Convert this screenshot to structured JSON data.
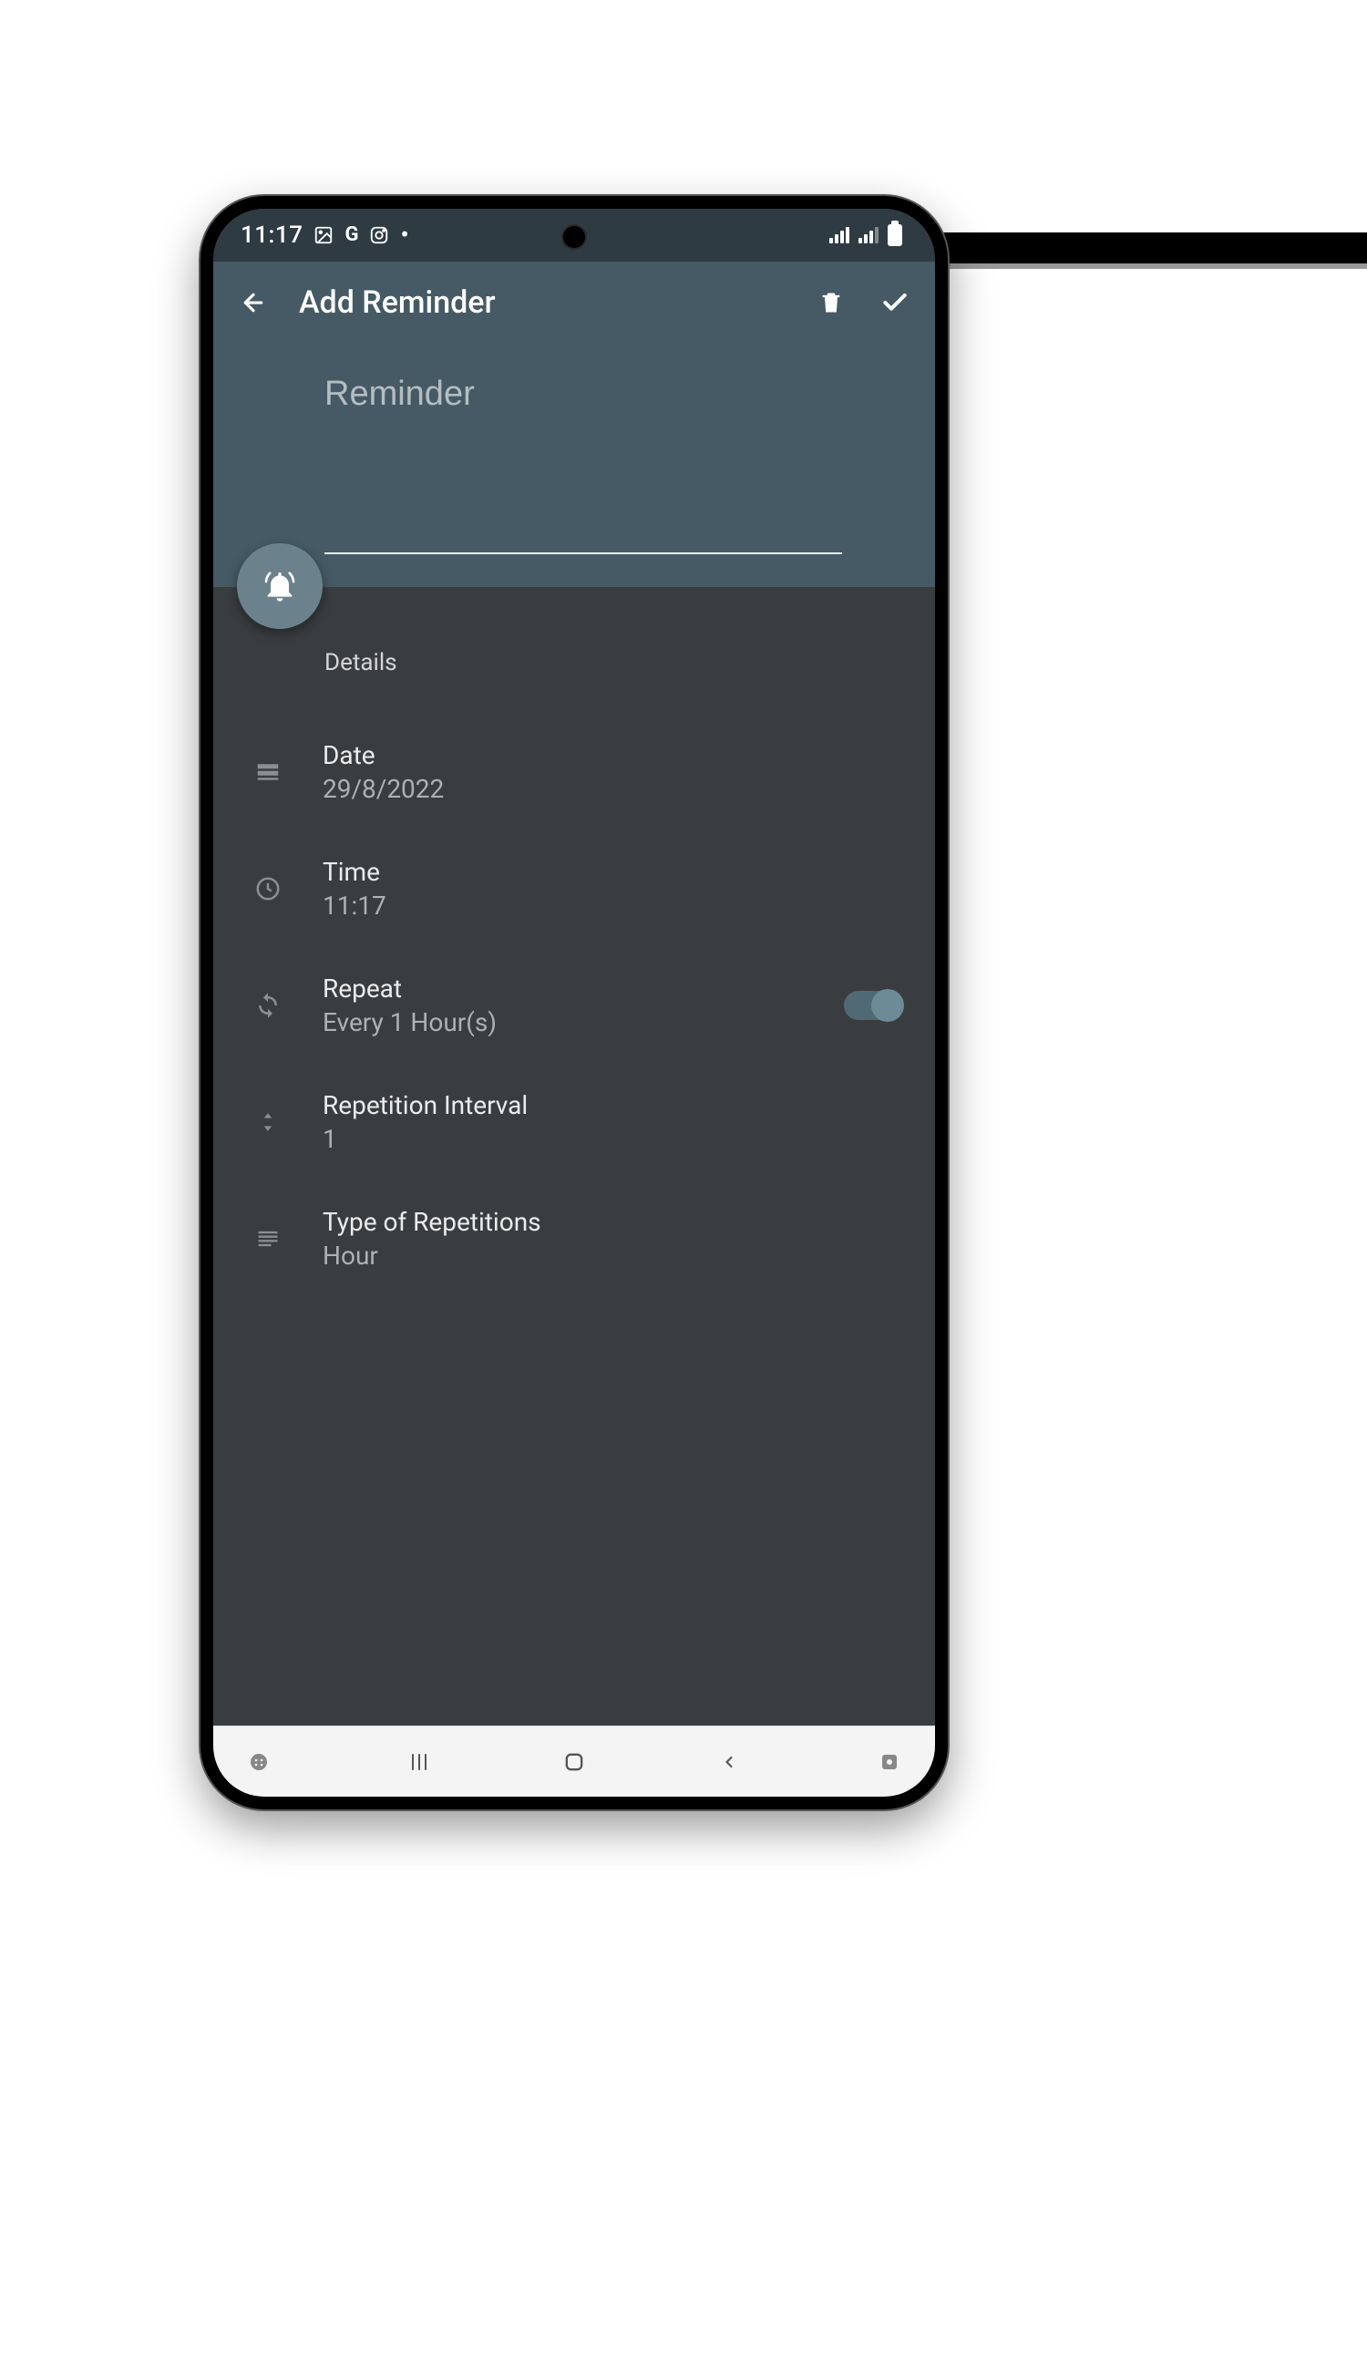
{
  "status": {
    "time": "11:17",
    "left_icons": [
      "image-icon",
      "google-g",
      "instagram",
      "dot"
    ]
  },
  "appbar": {
    "title": "Add Reminder"
  },
  "hero": {
    "placeholder": "Reminder",
    "value": ""
  },
  "details": {
    "heading": "Details",
    "rows": {
      "date": {
        "label": "Date",
        "value": "29/8/2022"
      },
      "time": {
        "label": "Time",
        "value": "11:17"
      },
      "repeat": {
        "label": "Repeat",
        "value": "Every 1 Hour(s)",
        "toggled": true
      },
      "interval": {
        "label": "Repetition Interval",
        "value": "1"
      },
      "type": {
        "label": "Type of Repetitions",
        "value": "Hour"
      }
    }
  },
  "colors": {
    "appbar_bg": "#455a64",
    "body_bg": "#3a3d40",
    "fab_bg": "#6b828c",
    "toggle_track": "#4f6a75",
    "toggle_knob": "#6d8a97"
  }
}
